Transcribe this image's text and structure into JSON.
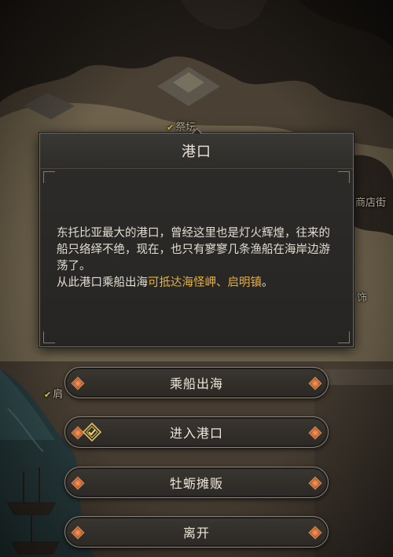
{
  "map": {
    "labels": [
      {
        "id": "altar",
        "text": "祭坛",
        "checked": true
      },
      {
        "id": "shop_street",
        "text": "商店街",
        "checked": false
      },
      {
        "id": "partial_right",
        "text": "饰",
        "checked": false
      },
      {
        "id": "partial_left",
        "text": "肩",
        "checked": true
      }
    ]
  },
  "dialog": {
    "title": "港口",
    "description": "东托比亚最大的港口，曾经这里也是灯火辉煌，往来的船只络绎不绝，现在，也只有寥寥几条渔船在海岸边游荡了。",
    "route_prefix": "从此港口乘船出海",
    "route_destinations": "可抵达海怪岬、启明镇",
    "route_suffix": "。"
  },
  "actions": [
    {
      "id": "sail",
      "label": "乘船出海",
      "icon": null
    },
    {
      "id": "enter_port",
      "label": "进入港口",
      "icon": "quest-marker-icon"
    },
    {
      "id": "oyster_stall",
      "label": "牡蛎摊贩",
      "icon": null
    },
    {
      "id": "leave",
      "label": "离开",
      "icon": null
    }
  ],
  "colors": {
    "highlight": "#e8b23a",
    "text": "#e2ddd3",
    "gem": "#e0733a"
  }
}
